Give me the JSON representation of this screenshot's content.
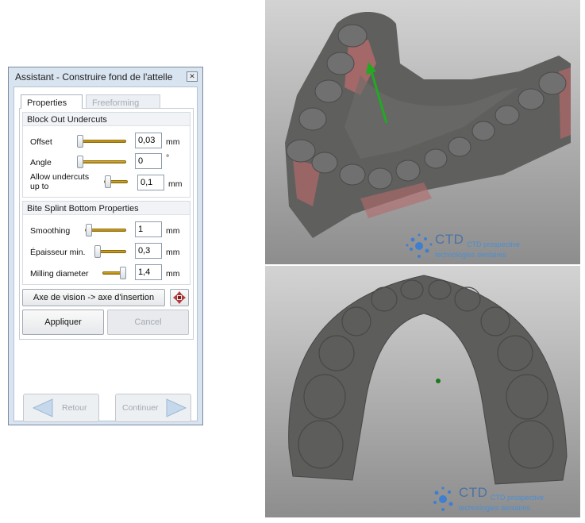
{
  "dialog": {
    "title": "Assistant - Construire fond de l'attelle",
    "close_glyph": "✕",
    "tabs": [
      {
        "label": "Properties",
        "active": true
      },
      {
        "label": "Freeforming",
        "active": false
      }
    ],
    "block_out": {
      "header": "Block Out Undercuts",
      "rows": [
        {
          "label": "Offset",
          "value": "0,03",
          "unit": "mm",
          "slider_fraction": 0.0
        },
        {
          "label": "Angle",
          "value": "0",
          "unit": "°",
          "slider_fraction": 0.0
        },
        {
          "label_line1": "Allow undercuts",
          "label_line2": "up to",
          "value": "0,1",
          "unit": "mm",
          "slider_fraction": 0.1
        }
      ]
    },
    "bite_splint": {
      "header": "Bite Splint Bottom Properties",
      "rows": [
        {
          "label": "Smoothing",
          "value": "1",
          "unit": "mm",
          "slider_fraction": 0.05
        },
        {
          "label": "Épaisseur min.",
          "value": "0,3",
          "unit": "mm",
          "slider_fraction": 0.2
        },
        {
          "label": "Milling diameter",
          "value": "1,4",
          "unit": "mm",
          "slider_fraction": 0.98
        }
      ]
    },
    "axis_button": "Axe de vision -> axe d'insertion",
    "axis_icon": "move-arrows-icon",
    "apply_button": "Appliquer",
    "cancel_button": "Cancel",
    "back_button": "Retour",
    "continue_button": "Continuer"
  },
  "viewports": {
    "logo_top": {
      "name": "CTD",
      "line1": "CTD prospective",
      "line2": "technologies dentaires"
    },
    "logo_bottom": {
      "name": "CTD",
      "line1": "CTD prospective",
      "line2": "technologies dentaires"
    }
  },
  "colors": {
    "slider": "#d6a21c",
    "model_gray": "#5d5d5b",
    "undercut_red": "#c46a6a",
    "axis_green": "#22aa22",
    "logo_blue": "#4b8fd4"
  }
}
